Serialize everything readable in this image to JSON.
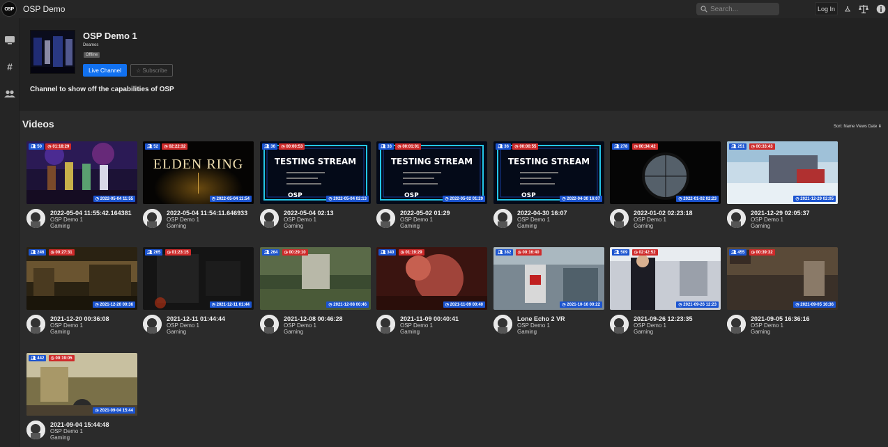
{
  "header": {
    "app_title": "OSP Demo",
    "logo_text": "OSP",
    "search_placeholder": "Search...",
    "login_label": "Log In"
  },
  "channel": {
    "name": "OSP Demo 1",
    "owner": "Deamos",
    "status": "Offline",
    "live_button": "Live Channel",
    "subscribe_button": "☆ Subscribe",
    "description": "Channel to show off the capabilities of OSP"
  },
  "videos_section": {
    "title": "Videos",
    "sort_label": "Sort: Name Views Date ⬇"
  },
  "videos": [
    {
      "title": "2022-05-04 11:55:42.164381",
      "owner": "OSP Demo 1",
      "topic": "Gaming",
      "views": "50",
      "duration": "01:18:29",
      "date": "2022-05-04 11:55",
      "thumb": "party"
    },
    {
      "title": "2022-05-04 11:54:11.646933",
      "owner": "OSP Demo 1",
      "topic": "Gaming",
      "views": "52",
      "duration": "02:22:32",
      "date": "2022-05-04 11:54",
      "thumb": "elden"
    },
    {
      "title": "2022-05-04 02:13",
      "owner": "OSP Demo 1",
      "topic": "Gaming",
      "views": "36",
      "duration": "00:00:53",
      "date": "2022-05-04 02:13",
      "thumb": "testing"
    },
    {
      "title": "2022-05-02 01:29",
      "owner": "OSP Demo 1",
      "topic": "Gaming",
      "views": "33",
      "duration": "00:01:01",
      "date": "2022-05-02 01:29",
      "thumb": "testing"
    },
    {
      "title": "2022-04-30 16:07",
      "owner": "OSP Demo 1",
      "topic": "Gaming",
      "views": "36",
      "duration": "00:00:55",
      "date": "2022-04-30 16:07",
      "thumb": "testing"
    },
    {
      "title": "2022-01-02 02:23:18",
      "owner": "OSP Demo 1",
      "topic": "Gaming",
      "views": "278",
      "duration": "00:34:42",
      "date": "2022-01-02 02:23",
      "thumb": "scope"
    },
    {
      "title": "2021-12-29 02:05:37",
      "owner": "OSP Demo 1",
      "topic": "Gaming",
      "views": "251",
      "duration": "00:33:43",
      "date": "2021-12-29 02:05",
      "thumb": "snow"
    },
    {
      "title": "2021-12-20 00:36:08",
      "owner": "OSP Demo 1",
      "topic": "Gaming",
      "views": "246",
      "duration": "00:27:31",
      "date": "2021-12-20 00:36",
      "thumb": "warehouse"
    },
    {
      "title": "2021-12-11 01:44:44",
      "owner": "OSP Demo 1",
      "topic": "Gaming",
      "views": "265",
      "duration": "01:23:15",
      "date": "2021-12-11 01:44",
      "thumb": "dark"
    },
    {
      "title": "2021-12-08 00:46:28",
      "owner": "OSP Demo 1",
      "topic": "Gaming",
      "views": "264",
      "duration": "00:29:10",
      "date": "2021-12-08 00:46",
      "thumb": "forest"
    },
    {
      "title": "2021-11-09 00:40:41",
      "owner": "OSP Demo 1",
      "topic": "Gaming",
      "views": "340",
      "duration": "01:19:29",
      "date": "2021-11-09 00:40",
      "thumb": "cave"
    },
    {
      "title": "Lone Echo 2 VR",
      "owner": "OSP Demo 1",
      "topic": "Gaming",
      "views": "382",
      "duration": "00:16:40",
      "date": "2021-10-16 00:22",
      "thumb": "echo"
    },
    {
      "title": "2021-09-26 12:23:35",
      "owner": "OSP Demo 1",
      "topic": "Gaming",
      "views": "509",
      "duration": "02:42:52",
      "date": "2021-09-26 12:23",
      "thumb": "scifi"
    },
    {
      "title": "2021-09-05 16:36:16",
      "owner": "OSP Demo 1",
      "topic": "Gaming",
      "views": "455",
      "duration": "00:39:32",
      "date": "2021-09-05 16:36",
      "thumb": "hud"
    },
    {
      "title": "2021-09-04 15:44:48",
      "owner": "OSP Demo 1",
      "topic": "Gaming",
      "views": "442",
      "duration": "00:19:05",
      "date": "2021-09-04 15:44",
      "thumb": "desert"
    }
  ]
}
